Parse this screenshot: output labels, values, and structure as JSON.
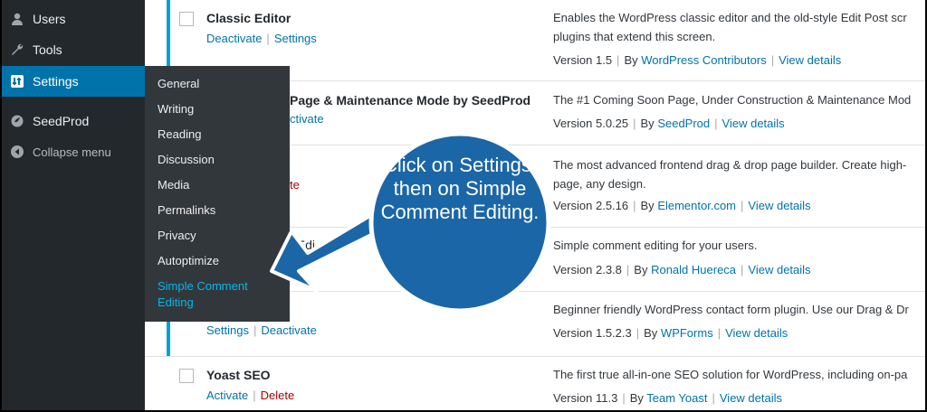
{
  "menu": {
    "items": [
      {
        "label": "Users",
        "icon": "users-icon"
      },
      {
        "label": "Tools",
        "icon": "wrench-icon"
      },
      {
        "label": "Settings",
        "icon": "settings-icon"
      },
      {
        "label": "SeedProd",
        "icon": "seedprod-icon"
      },
      {
        "label": "Collapse menu",
        "icon": "collapse-icon"
      }
    ],
    "active_color": "#0073aa"
  },
  "submenu": [
    "General",
    "Writing",
    "Reading",
    "Discussion",
    "Media",
    "Permalinks",
    "Privacy",
    "Autoptimize",
    "Simple Comment Editing"
  ],
  "plugins": [
    {
      "name": "Classic Editor",
      "actions": [
        "Deactivate",
        "Settings"
      ],
      "desc": [
        "Enables the WordPress classic editor and the old-style Edit Post scr",
        "plugins that extend this screen."
      ],
      "version": "Version 1.5",
      "by": "WordPress Contributors",
      "details": "View details"
    },
    {
      "name": "Page & Maintenance Mode by SeedProd",
      "actions": [
        "ctivate"
      ],
      "desc": [
        "The #1 Coming Soon Page, Under Construction & Maintenance Mod"
      ],
      "version": "Version 5.0.25",
      "by": "SeedProd",
      "details": "View details"
    },
    {
      "name": "",
      "actions": [
        "te"
      ],
      "desc": [
        "The most advanced frontend drag & drop page builder. Create high-",
        "page, any design."
      ],
      "version": "Version 2.5.16",
      "by": "Elementor.com",
      "details": "View details"
    },
    {
      "name": "t Edi",
      "actions": [],
      "desc": [
        "Simple comment editing for your users."
      ],
      "version": "Version 2.3.8",
      "by": "Ronald Huereca",
      "details": "View details"
    },
    {
      "name": "",
      "actions": [
        "Settings",
        "Deactivate"
      ],
      "desc": [
        "Beginner friendly WordPress contact form plugin. Use our Drag & Dr"
      ],
      "version": "Version 1.5.2.3",
      "by": "WPForms",
      "details": "View details"
    },
    {
      "name": "Yoast SEO",
      "actions": [
        "Activate",
        "Delete"
      ],
      "desc": [
        "The first true all-in-one SEO solution for WordPress, including on-pa"
      ],
      "version": "Version 11.3",
      "by": "Team Yoast",
      "details": "View details"
    }
  ],
  "callout": {
    "text": "Click on Settings, then on Simple Comment Editing.",
    "color": "#1b66a6"
  }
}
